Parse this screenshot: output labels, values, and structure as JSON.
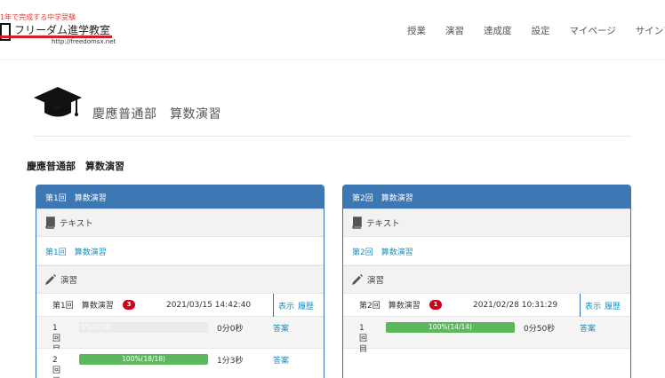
{
  "brand": {
    "tagline": "1年で完成する中学受験",
    "name": "フリーダム進学教室",
    "url": "http://freedomsx.net"
  },
  "nav": [
    "授業",
    "演習",
    "達成度",
    "設定",
    "マイページ",
    "サインアウト"
  ],
  "page_title": "慶應普通部　算数演習",
  "section_title": "慶應普通部　算数演習",
  "panels": [
    {
      "header": "第1回　算数演習",
      "text_section": "テキスト",
      "text_link": "第1回　算数演習",
      "exercise_section": "演習",
      "exercise": {
        "title": "第1回　算数演習",
        "badge": "3",
        "datetime": "2021/03/15 14:42:40",
        "display": "表示",
        "history": "履歴"
      },
      "rows": [
        {
          "num": "1回目",
          "progress_label": "0%(0/18)",
          "progress": 0.0,
          "time": "0分0秒",
          "answer": "答案"
        },
        {
          "num": "2回目",
          "progress_label": "100%(18/18)",
          "progress": 1.0,
          "time": "1分3秒",
          "answer": "答案"
        }
      ]
    },
    {
      "header": "第2回　算数演習",
      "text_section": "テキスト",
      "text_link": "第2回　算数演習",
      "exercise_section": "演習",
      "exercise": {
        "title": "第2回　算数演習",
        "badge": "1",
        "datetime": "2021/02/28 10:31:29",
        "display": "表示",
        "history": "履歴"
      },
      "rows": [
        {
          "num": "1回目",
          "progress_label": "100%(14/14)",
          "progress": 1.0,
          "time": "0分50秒",
          "answer": "答案"
        }
      ]
    }
  ],
  "colors": {
    "panel_header": "#3d78b5",
    "link": "#1a8fbc",
    "progress": "#5cb85c",
    "badge": "#d0021b"
  }
}
